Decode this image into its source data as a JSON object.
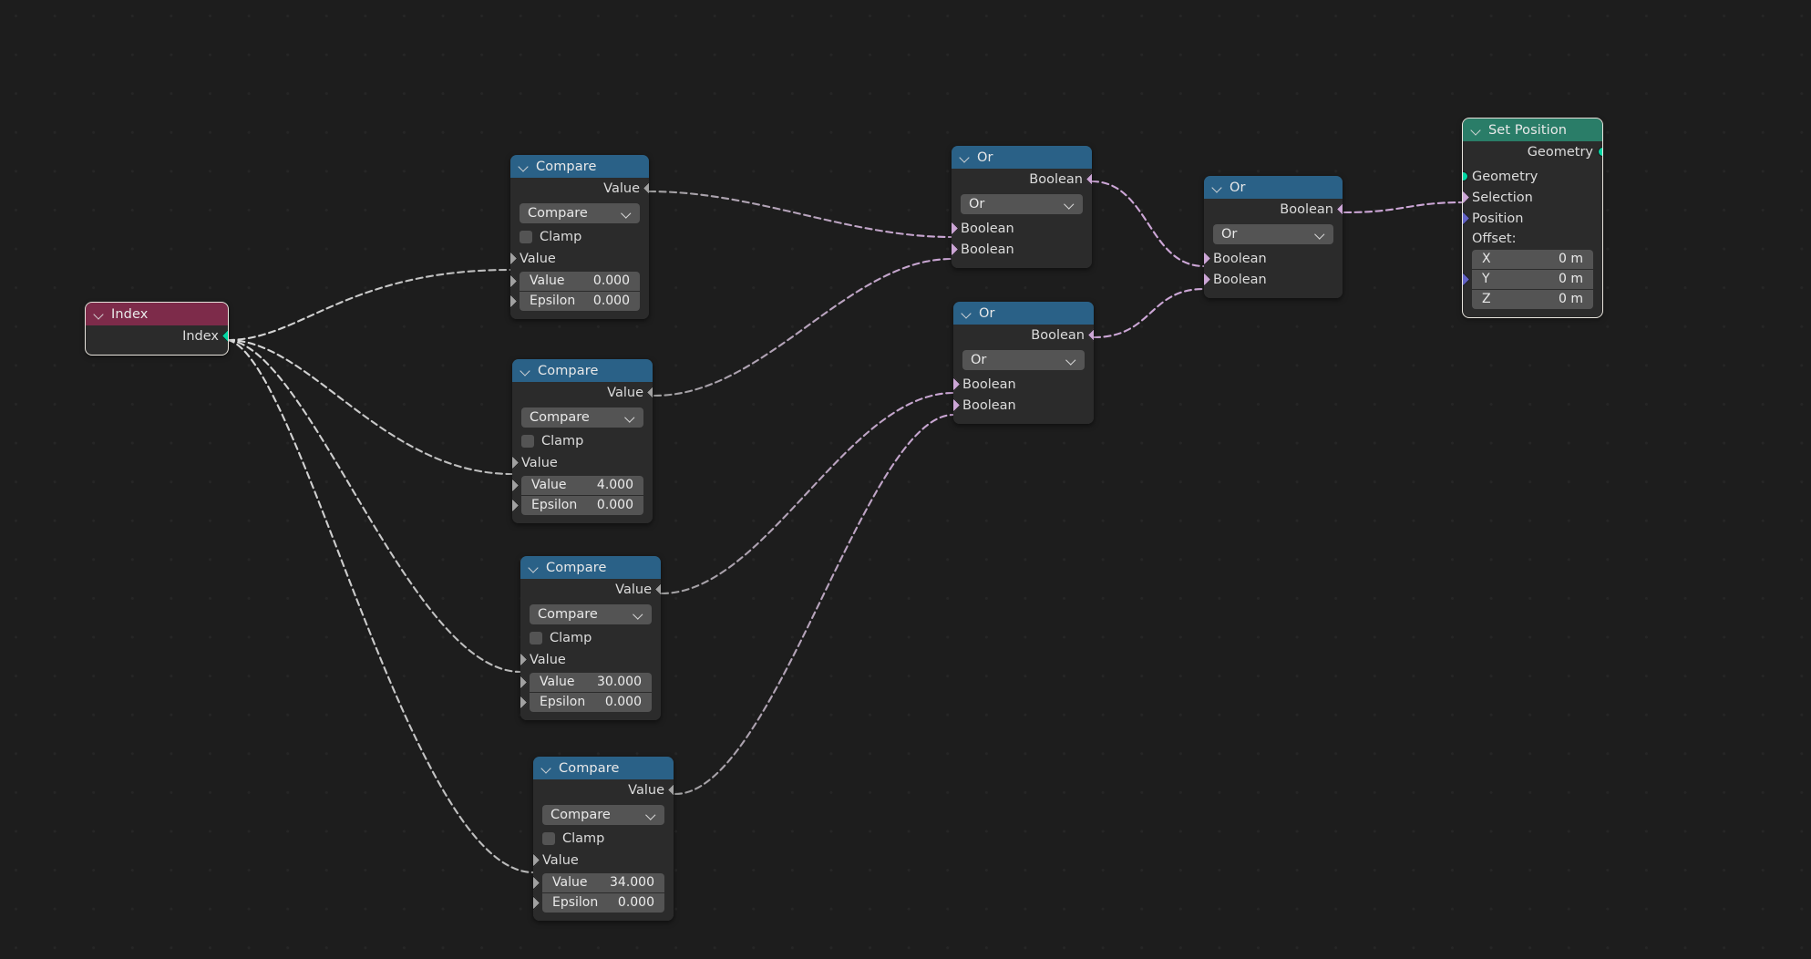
{
  "app": {
    "editor": "blender-geometry-node-editor",
    "background_color": "#1d1d1d",
    "grid_dot_color": "#262626"
  },
  "colors": {
    "header_input": "#7d2b4a",
    "header_converter": "#2a6187",
    "header_geometry": "#2a7d68",
    "socket_value": "#a1a1a1",
    "socket_boolean": "#cca6d6",
    "socket_geometry": "#00d6a3",
    "socket_vector": "#6363c7",
    "node_body": "#2b2b2b",
    "widget": "#545454"
  },
  "nodes": [
    {
      "id": "index",
      "title": "Index",
      "outputs": [
        {
          "label": "Index",
          "type": "value"
        }
      ],
      "inputs": []
    },
    {
      "id": "compare-1",
      "title": "Compare",
      "outputs": [
        {
          "label": "Value",
          "type": "value"
        }
      ],
      "operation": "Compare",
      "clamp_label": "Clamp",
      "clamp_checked": false,
      "input_socket_label": "Value",
      "fields": [
        {
          "label": "Value",
          "value": "0.000"
        },
        {
          "label": "Epsilon",
          "value": "0.000"
        }
      ]
    },
    {
      "id": "compare-2",
      "title": "Compare",
      "outputs": [
        {
          "label": "Value",
          "type": "value"
        }
      ],
      "operation": "Compare",
      "clamp_label": "Clamp",
      "clamp_checked": false,
      "input_socket_label": "Value",
      "fields": [
        {
          "label": "Value",
          "value": "4.000"
        },
        {
          "label": "Epsilon",
          "value": "0.000"
        }
      ]
    },
    {
      "id": "compare-3",
      "title": "Compare",
      "outputs": [
        {
          "label": "Value",
          "type": "value"
        }
      ],
      "operation": "Compare",
      "clamp_label": "Clamp",
      "clamp_checked": false,
      "input_socket_label": "Value",
      "fields": [
        {
          "label": "Value",
          "value": "30.000"
        },
        {
          "label": "Epsilon",
          "value": "0.000"
        }
      ]
    },
    {
      "id": "compare-4",
      "title": "Compare",
      "outputs": [
        {
          "label": "Value",
          "type": "value"
        }
      ],
      "operation": "Compare",
      "clamp_label": "Clamp",
      "clamp_checked": false,
      "input_socket_label": "Value",
      "fields": [
        {
          "label": "Value",
          "value": "34.000"
        },
        {
          "label": "Epsilon",
          "value": "0.000"
        }
      ]
    },
    {
      "id": "or-1",
      "title": "Or",
      "operation": "Or",
      "outputs": [
        {
          "label": "Boolean",
          "type": "boolean"
        }
      ],
      "inputs": [
        {
          "label": "Boolean",
          "type": "boolean"
        },
        {
          "label": "Boolean",
          "type": "boolean"
        }
      ]
    },
    {
      "id": "or-2",
      "title": "Or",
      "operation": "Or",
      "outputs": [
        {
          "label": "Boolean",
          "type": "boolean"
        }
      ],
      "inputs": [
        {
          "label": "Boolean",
          "type": "boolean"
        },
        {
          "label": "Boolean",
          "type": "boolean"
        }
      ]
    },
    {
      "id": "or-3",
      "title": "Or",
      "operation": "Or",
      "outputs": [
        {
          "label": "Boolean",
          "type": "boolean"
        }
      ],
      "inputs": [
        {
          "label": "Boolean",
          "type": "boolean"
        },
        {
          "label": "Boolean",
          "type": "boolean"
        }
      ]
    },
    {
      "id": "set-position",
      "title": "Set Position",
      "outputs": [
        {
          "label": "Geometry",
          "type": "geometry"
        }
      ],
      "inputs": [
        {
          "label": "Geometry",
          "type": "geometry"
        },
        {
          "label": "Selection",
          "type": "boolean"
        },
        {
          "label": "Position",
          "type": "vector"
        }
      ],
      "offset_label": "Offset:",
      "offset_fields": [
        {
          "label": "X",
          "value": "0 m"
        },
        {
          "label": "Y",
          "value": "0 m"
        },
        {
          "label": "Z",
          "value": "0 m"
        }
      ]
    }
  ],
  "index_node": {
    "title": "Index",
    "output_label": "Index"
  },
  "compare1": {
    "title": "Compare",
    "output_label": "Value",
    "operation": "Compare",
    "clamp": "Clamp",
    "value_socket": "Value",
    "f1_label": "Value",
    "f1_value": "0.000",
    "f2_label": "Epsilon",
    "f2_value": "0.000"
  },
  "compare2": {
    "title": "Compare",
    "output_label": "Value",
    "operation": "Compare",
    "clamp": "Clamp",
    "value_socket": "Value",
    "f1_label": "Value",
    "f1_value": "4.000",
    "f2_label": "Epsilon",
    "f2_value": "0.000"
  },
  "compare3": {
    "title": "Compare",
    "output_label": "Value",
    "operation": "Compare",
    "clamp": "Clamp",
    "value_socket": "Value",
    "f1_label": "Value",
    "f1_value": "30.000",
    "f2_label": "Epsilon",
    "f2_value": "0.000"
  },
  "compare4": {
    "title": "Compare",
    "output_label": "Value",
    "operation": "Compare",
    "clamp": "Clamp",
    "value_socket": "Value",
    "f1_label": "Value",
    "f1_value": "34.000",
    "f2_label": "Epsilon",
    "f2_value": "0.000"
  },
  "or1": {
    "title": "Or",
    "output_label": "Boolean",
    "operation": "Or",
    "in1": "Boolean",
    "in2": "Boolean"
  },
  "or2": {
    "title": "Or",
    "output_label": "Boolean",
    "operation": "Or",
    "in1": "Boolean",
    "in2": "Boolean"
  },
  "or3": {
    "title": "Or",
    "output_label": "Boolean",
    "operation": "Or",
    "in1": "Boolean",
    "in2": "Boolean"
  },
  "setpos": {
    "title": "Set Position",
    "output_label": "Geometry",
    "in_geometry": "Geometry",
    "in_selection": "Selection",
    "in_position": "Position",
    "offset_label": "Offset:",
    "x_label": "X",
    "x_value": "0 m",
    "y_label": "Y",
    "y_value": "0 m",
    "z_label": "Z",
    "z_value": "0 m"
  },
  "links": [
    {
      "from": "index.Index",
      "to": "compare-1.Value"
    },
    {
      "from": "index.Index",
      "to": "compare-2.Value"
    },
    {
      "from": "index.Index",
      "to": "compare-3.Value"
    },
    {
      "from": "index.Index",
      "to": "compare-4.Value"
    },
    {
      "from": "compare-1.Value",
      "to": "or-1.Boolean1"
    },
    {
      "from": "compare-2.Value",
      "to": "or-1.Boolean2"
    },
    {
      "from": "compare-3.Value",
      "to": "or-3.Boolean1"
    },
    {
      "from": "compare-4.Value",
      "to": "or-3.Boolean2"
    },
    {
      "from": "or-1.Boolean",
      "to": "or-2.Boolean1"
    },
    {
      "from": "or-3.Boolean",
      "to": "or-2.Boolean2"
    },
    {
      "from": "or-2.Boolean",
      "to": "set-position.Selection"
    }
  ]
}
